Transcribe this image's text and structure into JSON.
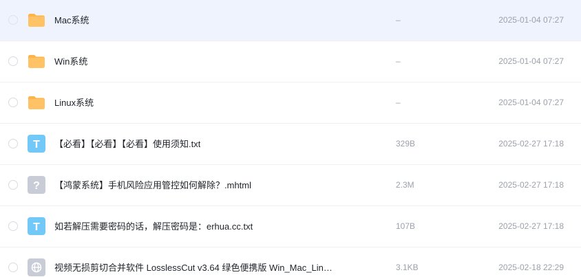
{
  "files": [
    {
      "name": "Mac系统",
      "size": "–",
      "date": "2025-01-04 07:27",
      "icon": "folder-icon",
      "selected": true
    },
    {
      "name": "Win系统",
      "size": "–",
      "date": "2025-01-04 07:27",
      "icon": "folder-icon",
      "selected": false
    },
    {
      "name": "Linux系统",
      "size": "–",
      "date": "2025-01-04 07:27",
      "icon": "folder-icon",
      "selected": false
    },
    {
      "name": "【必看】【必看】【必看】使用须知.txt",
      "size": "329B",
      "date": "2025-02-27 17:18",
      "icon": "text-file-icon",
      "icon_letter": "T",
      "selected": false
    },
    {
      "name": "【鸿蒙系统】手机风险应用管控如何解除？.mhtml",
      "size": "2.3M",
      "date": "2025-02-27 17:18",
      "icon": "unknown-file-icon",
      "icon_letter": "?",
      "selected": false
    },
    {
      "name": "如若解压需要密码的话，解压密码是：erhua.cc.txt",
      "size": "107B",
      "date": "2025-02-27 17:18",
      "icon": "text-file-icon",
      "icon_letter": "T",
      "selected": false
    },
    {
      "name": "视频无损剪切合并软件 LosslessCut v3.64 绿色便携版 Win_Mac_Lin…",
      "size": "3.1KB",
      "date": "2025-02-18 22:29",
      "icon": "web-link-icon",
      "selected": false
    }
  ],
  "colors": {
    "folder": "#ffc265",
    "folder_tab": "#ffb44a",
    "text_icon": "#72c8f7",
    "unknown_icon": "#c8ccd6",
    "web_icon": "#c8ccd6",
    "selected_row": "#eef3fd"
  }
}
